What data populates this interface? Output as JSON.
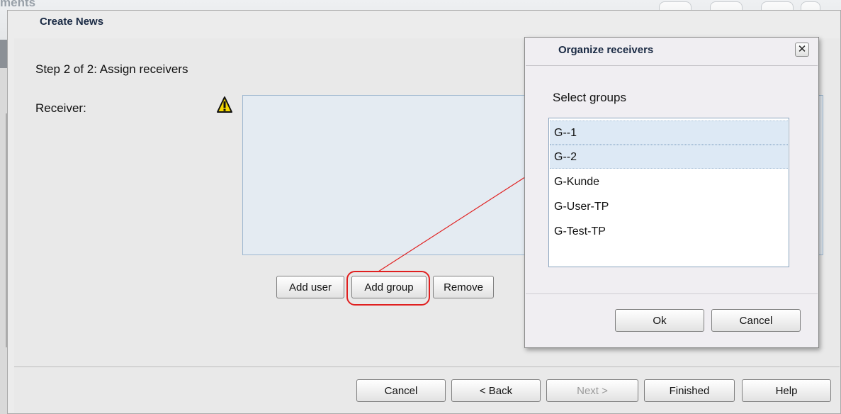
{
  "background": {
    "breadcrumb_fragment": "ments",
    "close_glyph": "✕",
    "toolbar_icons": [
      "edit-icon",
      "pencil-icon",
      "list-icon",
      "close-tool-icon"
    ]
  },
  "dialog": {
    "title": "Create News",
    "step_title": "Step 2 of 2: Assign receivers",
    "receiver_label": "Receiver:",
    "buttons": {
      "add_user": "Add user",
      "add_group": "Add group",
      "remove": "Remove"
    },
    "footer": {
      "cancel": "Cancel",
      "back": "< Back",
      "next": "Next >",
      "finished": "Finished",
      "help": "Help"
    }
  },
  "popup": {
    "title": "Organize receivers",
    "close_glyph": "✕",
    "select_label": "Select groups",
    "groups": [
      {
        "label": "G--1",
        "selected": true
      },
      {
        "label": "G--2",
        "selected": true
      },
      {
        "label": "G-Kunde",
        "selected": false
      },
      {
        "label": "G-User-TP",
        "selected": false
      },
      {
        "label": "G-Test-TP",
        "selected": false
      }
    ],
    "ok": "Ok",
    "cancel": "Cancel"
  },
  "colors": {
    "annotation": "#e02020",
    "selection": "#dde9f5",
    "warning": "#f5d800"
  }
}
